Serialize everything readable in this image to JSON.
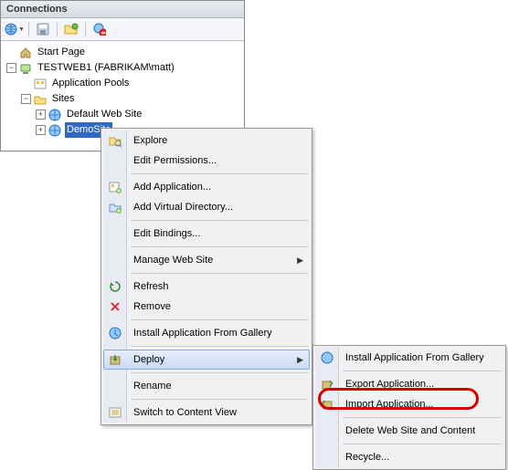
{
  "panel": {
    "title": "Connections"
  },
  "toolbar": {
    "connect": "connect",
    "save": "save",
    "folder": "open-folder",
    "remove": "remove-connection"
  },
  "tree": {
    "start_page": "Start Page",
    "server": "TESTWEB1 (FABRIKAM\\matt)",
    "app_pools": "Application Pools",
    "sites": "Sites",
    "default_site": "Default Web Site",
    "demo_site": "DemoSite"
  },
  "menu1": {
    "explore": "Explore",
    "edit_permissions": "Edit Permissions...",
    "add_application": "Add Application...",
    "add_vdir": "Add Virtual Directory...",
    "edit_bindings": "Edit Bindings...",
    "manage": "Manage Web Site",
    "refresh": "Refresh",
    "remove": "Remove",
    "install_gallery": "Install Application From Gallery",
    "deploy": "Deploy",
    "rename": "Rename",
    "switch_view": "Switch to Content View"
  },
  "menu2": {
    "install_gallery": "Install Application From Gallery",
    "export_app": "Export Application...",
    "import_app": "Import Application...",
    "delete_site": "Delete Web Site and Content",
    "recycle": "Recycle..."
  }
}
